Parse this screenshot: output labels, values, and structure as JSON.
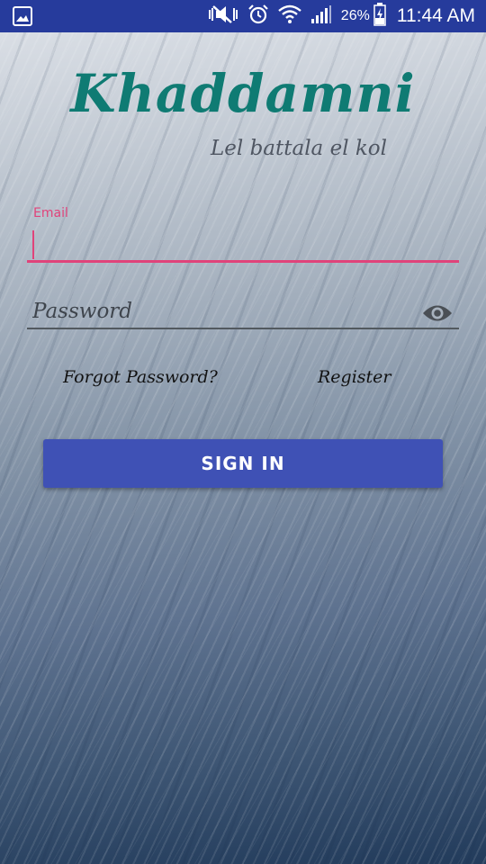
{
  "status_bar": {
    "battery_percent": "26%",
    "time": "11:44 AM",
    "icons": [
      "gallery-icon",
      "mute-vibrate-icon",
      "alarm-icon",
      "wifi-icon",
      "signal-icon",
      "battery-charging-icon"
    ],
    "background_color": "#263b9c"
  },
  "app": {
    "title": "Khaddamni",
    "subtitle": "Lel battala el kol",
    "title_color": "#0f7b73"
  },
  "login_form": {
    "email_label": "Email",
    "email_value": "",
    "password_placeholder": "Password",
    "password_value": "",
    "accent_color": "#e0437a"
  },
  "links": {
    "forgot_password": "Forgot Password?",
    "register": "Register"
  },
  "actions": {
    "sign_in_label": "SIGN IN",
    "button_color": "#3f51b5"
  }
}
